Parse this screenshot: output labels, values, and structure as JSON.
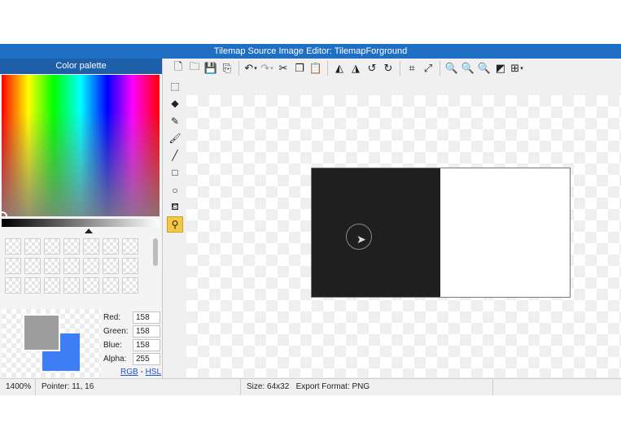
{
  "window": {
    "title": "Tilemap Source Image Editor: TilemapForground"
  },
  "palette": {
    "header": "Color palette",
    "swatch_count": 21,
    "primary_color": "#9e9e9e",
    "secondary_color": "#3d7ef5",
    "channels": [
      {
        "label": "Red:",
        "value": "158"
      },
      {
        "label": "Green:",
        "value": "158"
      },
      {
        "label": "Blue:",
        "value": "158"
      },
      {
        "label": "Alpha:",
        "value": "255"
      }
    ],
    "modes": {
      "rgb": "RGB",
      "separator": "-",
      "hsl": "HSL"
    }
  },
  "toolbar": {
    "icons": [
      "new-file-icon",
      "open-folder-icon",
      "save-icon",
      "save-as-icon",
      "undo-icon",
      "redo-icon",
      "cut-icon",
      "copy-icon",
      "paste-icon",
      "flip-horizontal-icon",
      "flip-vertical-icon",
      "rotate-left-icon",
      "rotate-right-icon",
      "crop-icon",
      "resize-icon",
      "zoom-in-icon",
      "zoom-out-icon",
      "zoom-fit-icon",
      "toggle-transparency-icon",
      "grid-icon"
    ]
  },
  "tools": {
    "items": [
      "marquee-select-icon",
      "eraser-icon",
      "pencil-icon",
      "brush-icon",
      "line-icon",
      "rectangle-icon",
      "ellipse-icon",
      "fill-bucket-icon",
      "eyedropper-icon"
    ],
    "active": "eyedropper-icon"
  },
  "canvas": {
    "dark_fill": "#1f1f1f",
    "light_fill": "#ffffff"
  },
  "status": {
    "zoom": "1400%",
    "pointer": "Pointer: 11, 16",
    "size": "Size: 64x32",
    "export_format": "Export Format: PNG"
  }
}
